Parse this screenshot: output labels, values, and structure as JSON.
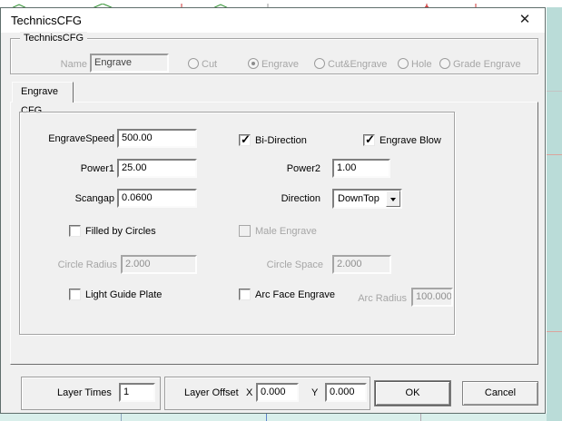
{
  "window": {
    "title": "TechnicsCFG",
    "close_icon": "✕"
  },
  "header_group": {
    "title": "TechnicsCFG",
    "name_label": "Name",
    "name_value": "Engrave",
    "radios": [
      {
        "label": "Cut",
        "selected": false
      },
      {
        "label": "Engrave",
        "selected": true
      },
      {
        "label": "Cut&Engrave",
        "selected": false
      },
      {
        "label": "Hole",
        "selected": false
      },
      {
        "label": "Grade Engrave",
        "selected": false
      }
    ]
  },
  "tab": {
    "label": "Engrave CFG"
  },
  "panel": {
    "engrave_speed": {
      "label": "EngraveSpeed",
      "value": "500.00"
    },
    "bi_direction": {
      "label": "Bi-Direction",
      "checked": true
    },
    "engrave_blow": {
      "label": "Engrave Blow",
      "checked": true
    },
    "power1": {
      "label": "Power1",
      "value": "25.00"
    },
    "power2": {
      "label": "Power2",
      "value": "1.00"
    },
    "scangap": {
      "label": "Scangap",
      "value": "0.0600"
    },
    "direction": {
      "label": "Direction",
      "value": "DownTop"
    },
    "filled_by_circles": {
      "label": "Filled by Circles",
      "checked": false
    },
    "male_engrave": {
      "label": "Male Engrave",
      "checked": false,
      "disabled": true
    },
    "circle_radius": {
      "label": "Circle Radius",
      "value": "2.000",
      "disabled": true
    },
    "circle_space": {
      "label": "Circle Space",
      "value": "2.000",
      "disabled": true
    },
    "light_guide_plate": {
      "label": "Light Guide Plate",
      "checked": false
    },
    "arc_face_engrave": {
      "label": "Arc Face Engrave",
      "checked": false
    },
    "arc_radius": {
      "label": "Arc Radius",
      "value": "100.000",
      "disabled": true
    }
  },
  "footer": {
    "layer_times": {
      "label": "Layer Times",
      "value": "1"
    },
    "layer_offset": {
      "label": "Layer Offset",
      "x_label": "X",
      "x_value": "0.000",
      "y_label": "Y",
      "y_value": "0.000"
    },
    "ok_label": "OK",
    "cancel_label": "Cancel"
  },
  "colors": {
    "dialog_bg": "#f0f0f0",
    "titlebar_bg": "#ffffff",
    "canvas_right": "#badcd8",
    "canvas_bottom": "#d9efeb",
    "disabled_text": "#a6a6a6",
    "line_green": "#2e8f2e",
    "line_red": "#cc3333"
  }
}
